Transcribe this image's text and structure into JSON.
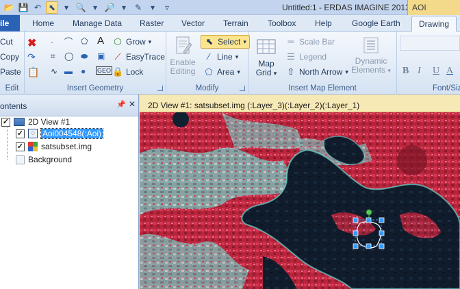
{
  "window": {
    "title": "Untitled:1 - ERDAS IMAGINE 2013",
    "context_tab": "AOI"
  },
  "tabs": [
    {
      "label": "ile"
    },
    {
      "label": "Home"
    },
    {
      "label": "Manage Data"
    },
    {
      "label": "Raster"
    },
    {
      "label": "Vector"
    },
    {
      "label": "Terrain"
    },
    {
      "label": "Toolbox"
    },
    {
      "label": "Help"
    },
    {
      "label": "Google Earth"
    },
    {
      "label": "Drawing"
    }
  ],
  "ribbon": {
    "edit": {
      "label": "Edit",
      "cut": "Cut",
      "copy": "Copy",
      "paste": "Paste"
    },
    "insert_geometry": {
      "label": "Insert Geometry",
      "text_tool": "A",
      "grow": "Grow",
      "easytrace": "EasyTrace",
      "lock": "Lock"
    },
    "modify": {
      "label": "Modify",
      "enable_editing": [
        "Enable",
        "Editing"
      ],
      "select": "Select",
      "line": "Line",
      "area": "Area"
    },
    "insert_map_element": {
      "label": "Insert Map Element",
      "map_grid": [
        "Map",
        "Grid"
      ],
      "scale_bar": "Scale Bar",
      "legend": "Legend",
      "north_arrow": "North Arrow",
      "dynamic_elements": [
        "Dynamic",
        "Elements"
      ]
    },
    "font": {
      "label": "Font/Siz",
      "bold": "B",
      "italic": "I",
      "underline": "U",
      "color": "A"
    }
  },
  "contents_panel": {
    "title": "ontents",
    "items": [
      {
        "label": "2D View #1",
        "checked": true
      },
      {
        "label": "Aoi004548(:Aoi)",
        "checked": true
      },
      {
        "label": "satsubset.img",
        "checked": true
      },
      {
        "label": "Background",
        "checked": false
      }
    ]
  },
  "view": {
    "title": "2D View #1: satsubset.img (:Layer_3)(:Layer_2)(:Layer_1)"
  },
  "colors": {
    "file_tab": "#2a62b6",
    "context_tab": "#f3d98a",
    "selection": "#3399ff",
    "vegetation": "#c0283e",
    "water": "#0f1e2e",
    "soil": "#8fc8c0"
  }
}
